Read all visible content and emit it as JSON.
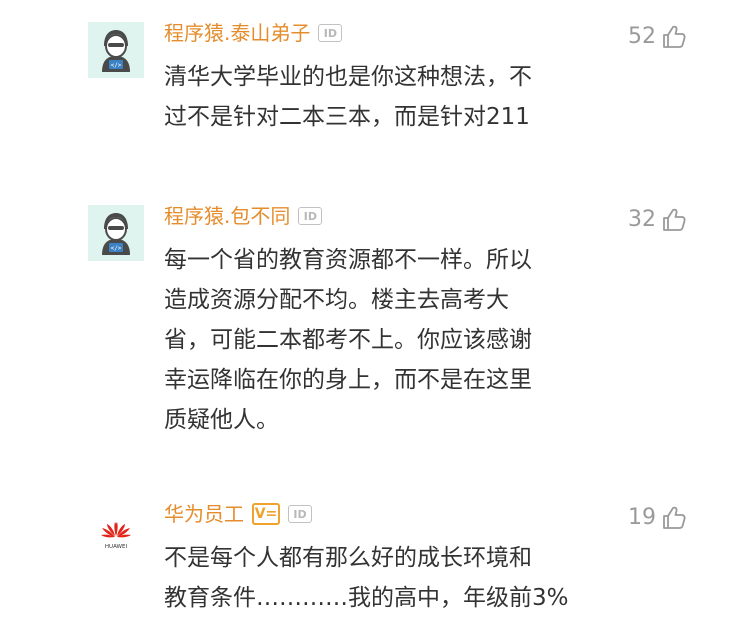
{
  "comments": [
    {
      "username": "程序猿.泰山弟子",
      "id_badge": "ID",
      "likes": "52",
      "text_lines": [
        "清华大学毕业的也是你这种想法，不",
        "过不是针对二本三本，而是针对211"
      ]
    },
    {
      "username": "程序猿.包不同",
      "id_badge": "ID",
      "likes": "32",
      "text_lines": [
        "每一个省的教育资源都不一样。所以",
        "造成资源分配不均。楼主去高考大",
        "省，可能二本都考不上。你应该感谢",
        "幸运降临在你的身上，而不是在这里",
        "质疑他人。"
      ]
    },
    {
      "username": "华为员工",
      "verified_badge": "V=",
      "id_badge": "ID",
      "likes": "19",
      "avatar_text": "HUAWEI",
      "text_lines": [
        "不是每个人都有那么好的成长环境和",
        "教育条件…………我的高中，年级前3%"
      ]
    }
  ],
  "colors": {
    "username": "#e58d2c",
    "text": "#333333",
    "likes": "#9a9a9a",
    "coder_avatar_bg": "#dff4ee",
    "huawei_red": "#e1251b"
  },
  "icons": {
    "coder_avatar": "coder-avatar-icon",
    "huawei_logo": "huawei-logo-icon",
    "like": "thumbs-up-icon"
  }
}
